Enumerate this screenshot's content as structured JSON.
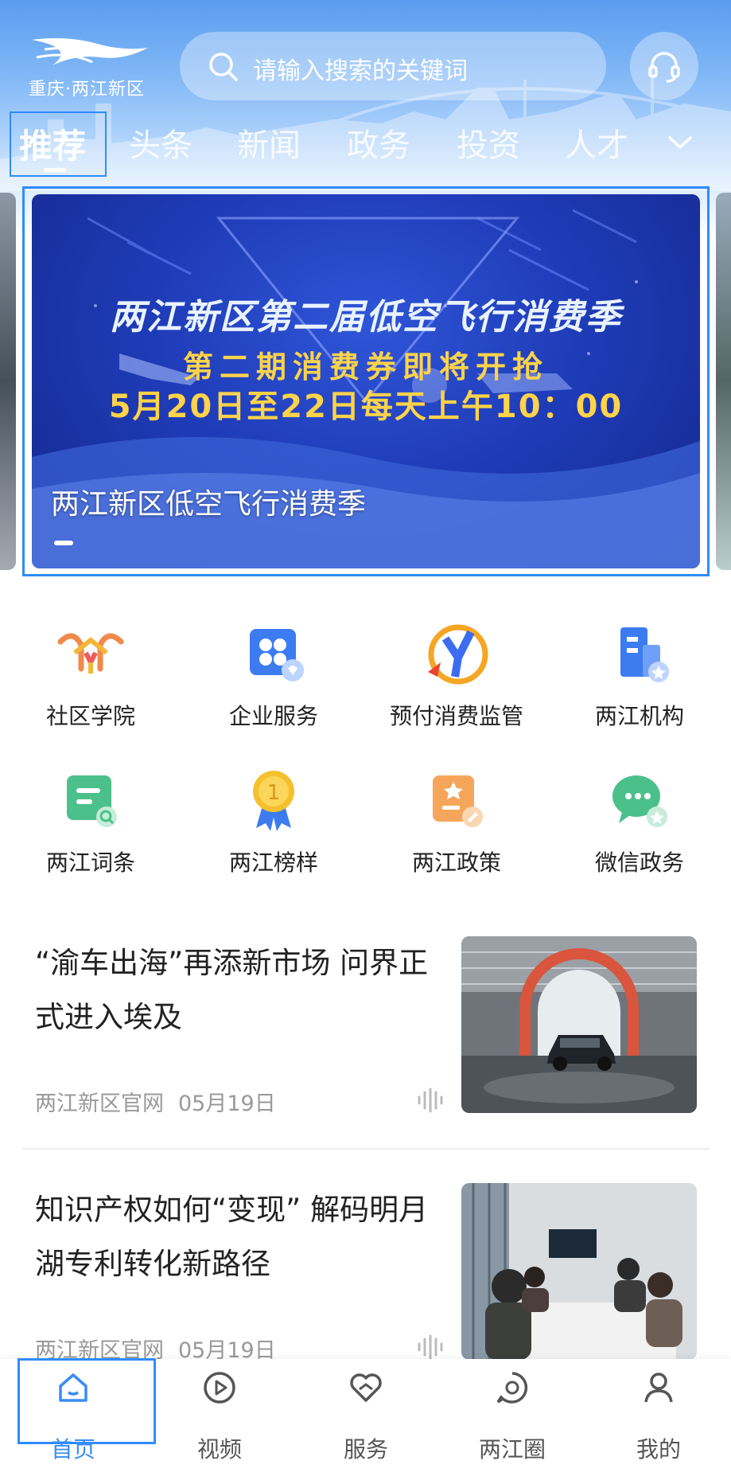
{
  "header": {
    "logo_text": "重庆·两江新区",
    "search_placeholder": "请输入搜索的关键词",
    "service_icon": "headset-icon"
  },
  "tabs": [
    {
      "label": "推荐",
      "active": true
    },
    {
      "label": "头条"
    },
    {
      "label": "新闻"
    },
    {
      "label": "政务"
    },
    {
      "label": "投资"
    },
    {
      "label": "人才"
    }
  ],
  "banner": {
    "title": "两江新区第二届低空飞行消费季",
    "subtitle": "第二期消费券即将开抢",
    "time": "5月20日至22日每天上午10：00",
    "caption": "两江新区低空飞行消费季"
  },
  "services": [
    {
      "label": "社区学院",
      "icon": "community-college-icon"
    },
    {
      "label": "企业服务",
      "icon": "enterprise-service-icon"
    },
    {
      "label": "预付消费监管",
      "icon": "prepaid-supervision-icon"
    },
    {
      "label": "两江机构",
      "icon": "institution-icon"
    },
    {
      "label": "两江词条",
      "icon": "glossary-icon"
    },
    {
      "label": "两江榜样",
      "icon": "medal-icon"
    },
    {
      "label": "两江政策",
      "icon": "policy-icon"
    },
    {
      "label": "微信政务",
      "icon": "wechat-gov-icon"
    }
  ],
  "news": [
    {
      "title": "“渝车出海”再添新市场 问界正式进入埃及",
      "source": "两江新区官网",
      "date": "05月19日"
    },
    {
      "title": "知识产权如何“变现” 解码明月湖专利转化新路径",
      "source": "两江新区官网",
      "date": "05月19日"
    }
  ],
  "bottom_nav": [
    {
      "label": "首页",
      "icon": "home-icon",
      "active": true
    },
    {
      "label": "视频",
      "icon": "video-play-icon"
    },
    {
      "label": "服务",
      "icon": "service-heart-icon"
    },
    {
      "label": "两江圈",
      "icon": "circle-chat-icon"
    },
    {
      "label": "我的",
      "icon": "user-icon"
    }
  ],
  "colors": {
    "accent": "#3a8cf4",
    "header_blue": "#5b9df0",
    "banner_yellow": "#ffd34a"
  }
}
